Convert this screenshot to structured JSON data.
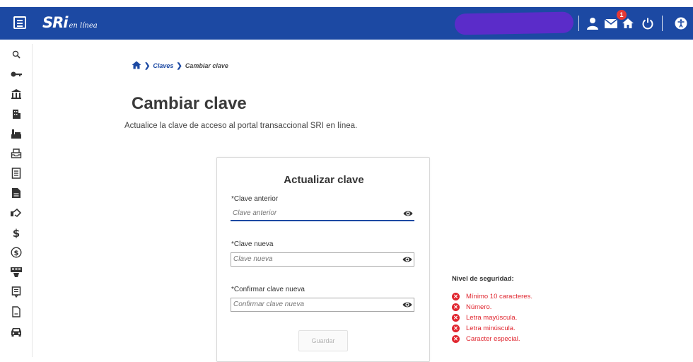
{
  "header": {
    "logo_main": "SRi",
    "logo_sub": "en línea",
    "notification_count": "1",
    "colors": {
      "bar": "#1c49a3",
      "accent": "#e0262f"
    },
    "icons": [
      "menu-icon",
      "user-icon",
      "mail-icon",
      "home-icon",
      "power-icon",
      "accessibility-icon"
    ]
  },
  "sidebar": {
    "icons": [
      "search-icon",
      "key-icon",
      "bank-icon",
      "building-icon",
      "factory-icon",
      "inbox-icon",
      "document-list-icon",
      "document-icon",
      "handshake-icon",
      "dollar-icon",
      "coin-icon",
      "cash-register-icon",
      "receipt-icon",
      "page-icon",
      "car-icon"
    ]
  },
  "breadcrumb": {
    "home_icon": "home-icon",
    "claves": "Claves",
    "current": "Cambiar clave"
  },
  "page": {
    "title": "Cambiar clave",
    "description": "Actualice la clave de acceso al portal transaccional SRI en línea."
  },
  "form": {
    "title": "Actualizar clave",
    "old_password": {
      "label": "*Clave anterior",
      "placeholder": "Clave anterior",
      "value": ""
    },
    "new_password": {
      "label": "*Clave nueva",
      "placeholder": "Clave nueva",
      "value": ""
    },
    "confirm_password": {
      "label": "*Confirmar clave nueva",
      "placeholder": "Confirmar clave nueva",
      "value": ""
    },
    "save_label": "Guardar"
  },
  "security": {
    "title": "Nivel de seguridad:",
    "rules": [
      "Mínimo 10 caracteres.",
      "Número.",
      "Letra mayúscula.",
      "Letra minúscula.",
      "Caracter especial."
    ]
  }
}
